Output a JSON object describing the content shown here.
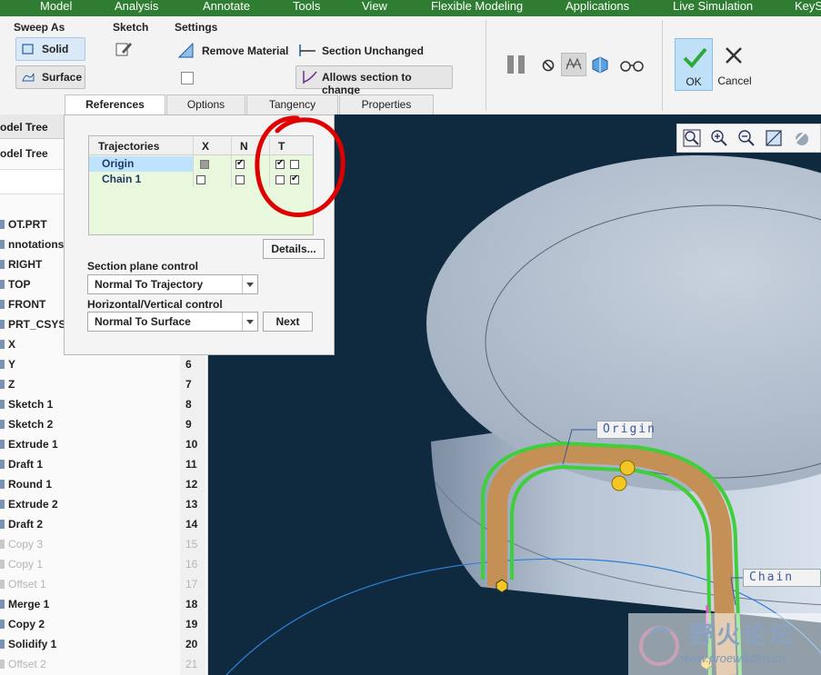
{
  "menu": [
    "Model",
    "Analysis",
    "Annotate",
    "Tools",
    "View",
    "Flexible Modeling",
    "Applications",
    "Live Simulation",
    "KeyS"
  ],
  "ribbon": {
    "sweep_as_label": "Sweep As",
    "solid_label": "Solid",
    "surface_label": "Surface",
    "sketch_label": "Sketch",
    "settings_label": "Settings",
    "remove_material_label": "Remove Material",
    "section_unchanged_label": "Section Unchanged",
    "allows_section_label": "Allows section to change",
    "ok_label": "OK",
    "cancel_label": "Cancel"
  },
  "tabs": [
    {
      "label": "References",
      "active": true
    },
    {
      "label": "Options",
      "active": false
    },
    {
      "label": "Tangency",
      "active": false
    },
    {
      "label": "Properties",
      "active": false
    }
  ],
  "panel": {
    "trajectories_header": "Trajectories",
    "col_x": "X",
    "col_n": "N",
    "col_t": "T",
    "rows": [
      {
        "name": "Origin",
        "x": "gray",
        "n": true,
        "t1": true,
        "t2": false
      },
      {
        "name": "Chain 1",
        "x": false,
        "n": false,
        "t1": false,
        "t2": true
      }
    ],
    "details_label": "Details...",
    "section_plane_label": "Section plane control",
    "section_plane_value": "Normal To Trajectory",
    "hv_label": "Horizontal/Vertical control",
    "hv_value": "Normal To Surface",
    "next_label": "Next"
  },
  "tree": {
    "tab1": "odel Tree",
    "title": "odel Tree",
    "items": [
      {
        "name": "OT.PRT",
        "num": ""
      },
      {
        "name": "nnotations",
        "num": ""
      },
      {
        "name": "RIGHT",
        "num": ""
      },
      {
        "name": "TOP",
        "num": ""
      },
      {
        "name": "FRONT",
        "num": ""
      },
      {
        "name": "PRT_CSYS",
        "num": ""
      },
      {
        "name": "X",
        "num": ""
      },
      {
        "name": "Y",
        "num": "6"
      },
      {
        "name": "Z",
        "num": "7"
      },
      {
        "name": "Sketch 1",
        "num": "8"
      },
      {
        "name": "Sketch 2",
        "num": "9"
      },
      {
        "name": "Extrude 1",
        "num": "10"
      },
      {
        "name": "Draft 1",
        "num": "11"
      },
      {
        "name": "Round 1",
        "num": "12"
      },
      {
        "name": "Extrude 2",
        "num": "13"
      },
      {
        "name": "Draft 2",
        "num": "14"
      },
      {
        "name": "Copy 3",
        "num": "15",
        "dim": true
      },
      {
        "name": "Copy 1",
        "num": "16",
        "dim": true
      },
      {
        "name": "Offset 1",
        "num": "17",
        "dim": true
      },
      {
        "name": "Merge 1",
        "num": "18"
      },
      {
        "name": "Copy 2",
        "num": "19"
      },
      {
        "name": "Solidify 1",
        "num": "20"
      },
      {
        "name": "Offset 2",
        "num": "21",
        "dim": true
      }
    ]
  },
  "graphics": {
    "origin_tag": "Origin",
    "chain_tag": "Chain"
  },
  "watermark": {
    "title": "野火论坛",
    "url": "www.proewildfire.cn"
  },
  "colors": {
    "menubar": "#2f7d32",
    "viewport": "#0f2a3e",
    "trajectory": "#3fcf3a",
    "highlight_row": "#bfe3ff",
    "red_annotation": "#e10000"
  }
}
